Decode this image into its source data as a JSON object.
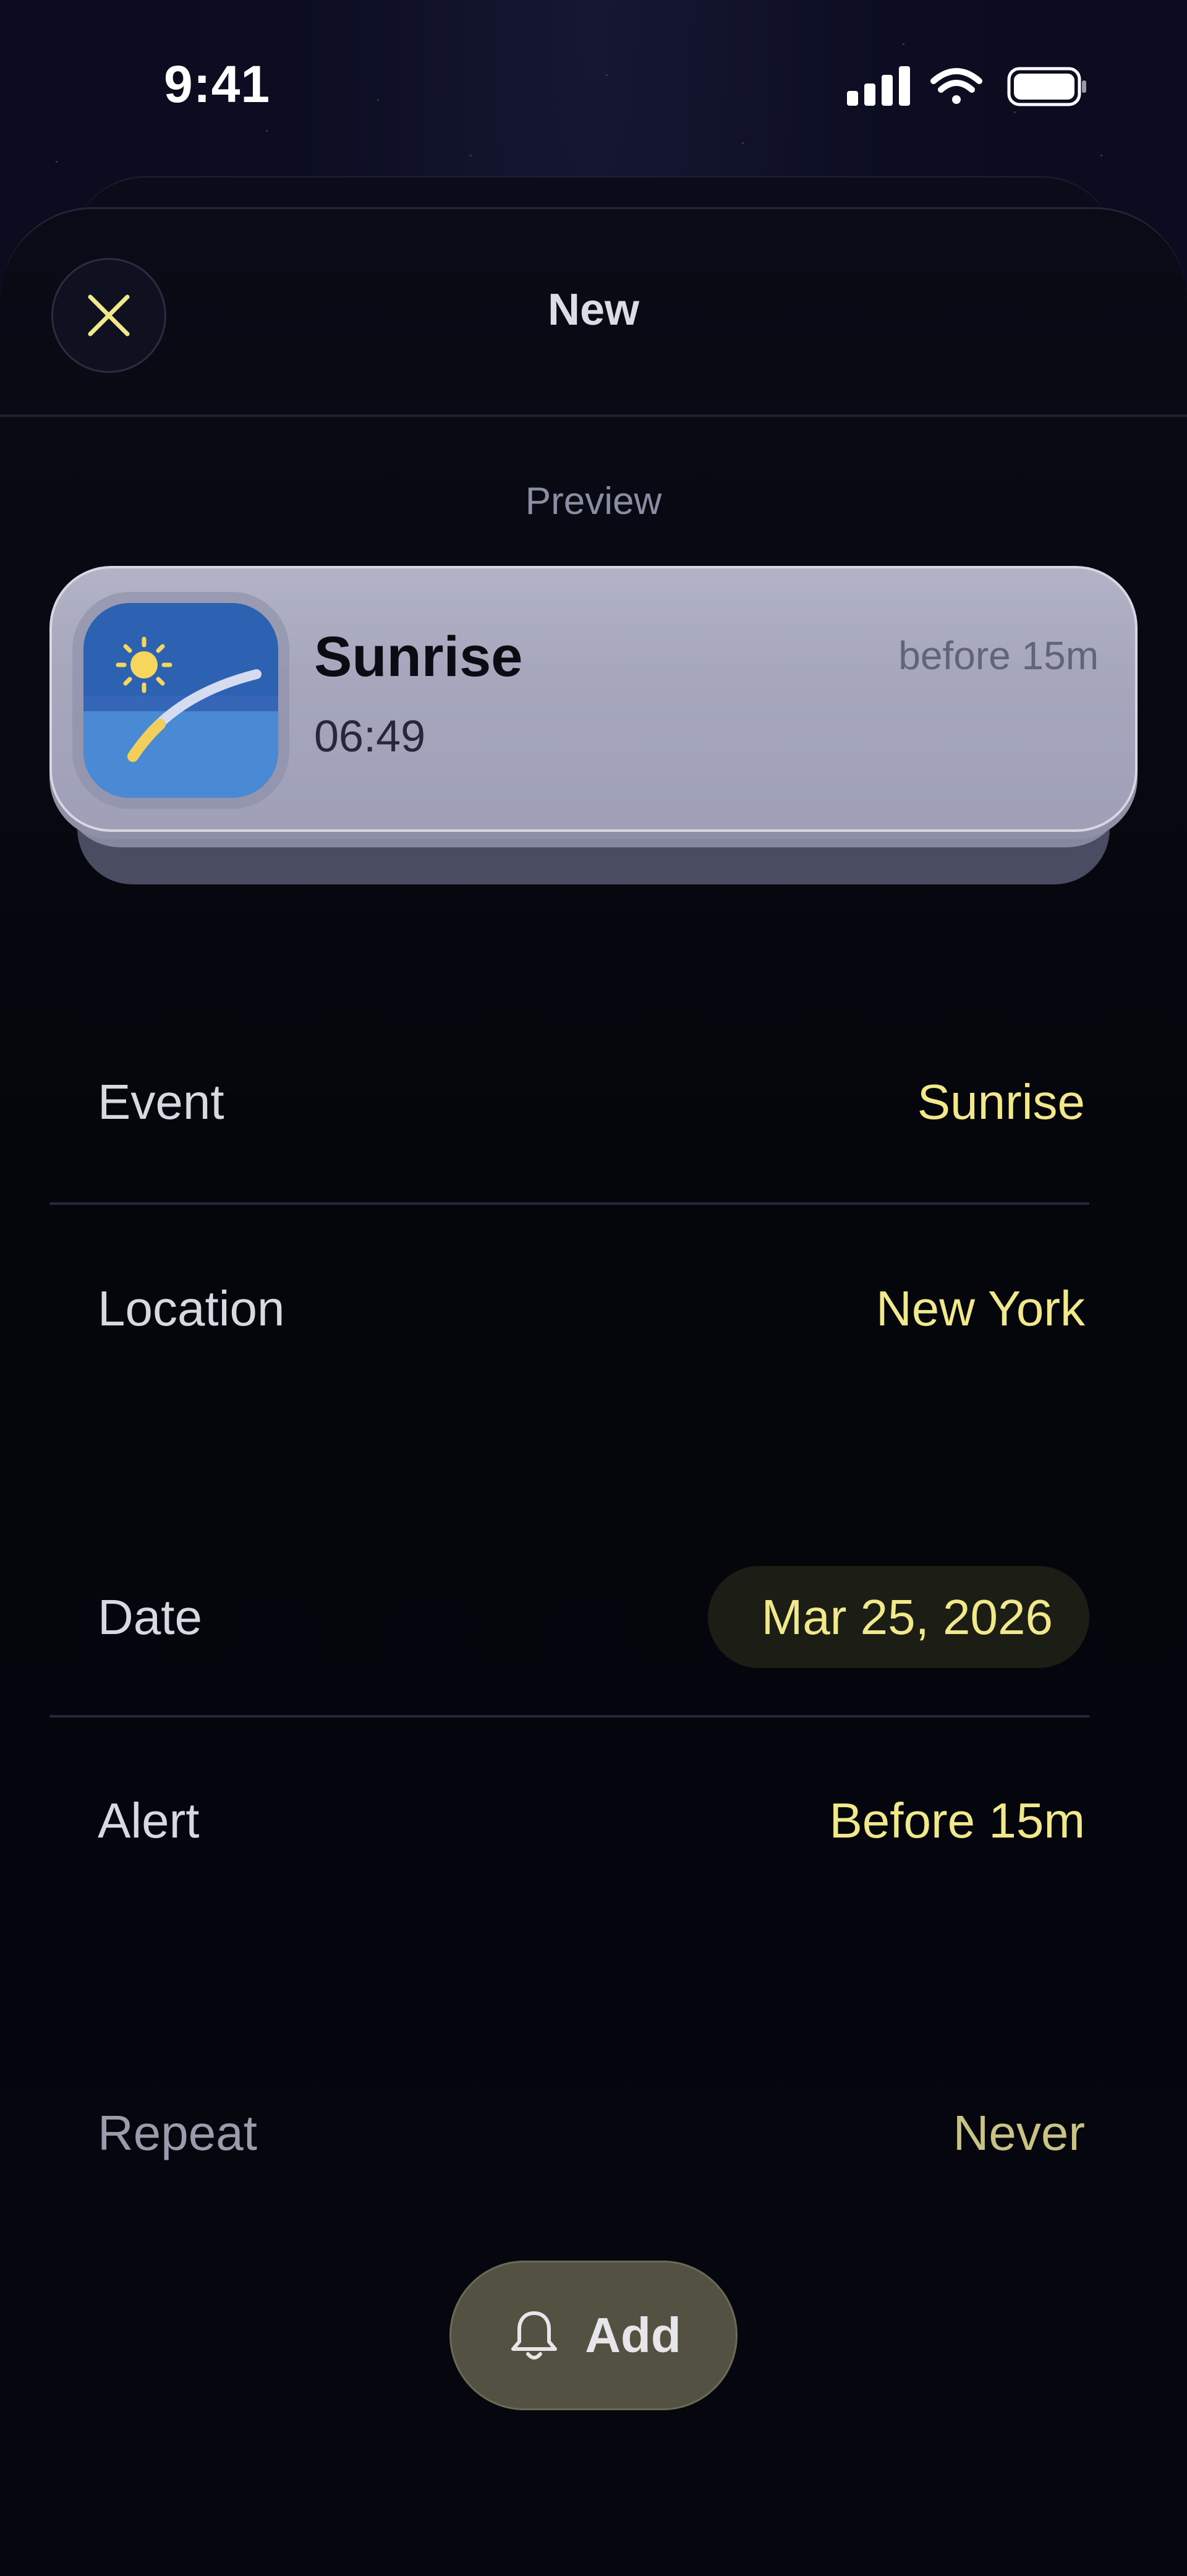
{
  "status_bar": {
    "time": "9:41",
    "icons": [
      "signal-icon",
      "wifi-icon",
      "battery-icon"
    ]
  },
  "header": {
    "title": "New",
    "close_icon": "close-icon"
  },
  "preview": {
    "label": "Preview",
    "notification": {
      "title": "Sunrise",
      "time": "06:49",
      "meta": "before 15m",
      "icon": "sunrise-app-icon"
    }
  },
  "rows": {
    "event": {
      "label": "Event",
      "value": "Sunrise"
    },
    "location": {
      "label": "Location",
      "value": "New York"
    },
    "date": {
      "label": "Date",
      "value": "Mar 25, 2026"
    },
    "alert": {
      "label": "Alert",
      "value": "Before 15m"
    },
    "repeat": {
      "label": "Repeat",
      "value": "Never"
    }
  },
  "add_button": {
    "label": "Add",
    "icon": "bell-icon"
  },
  "colors": {
    "accent": "#f0e88a",
    "background": "#05060e",
    "card": "#a6a7bd",
    "button": "#535242"
  }
}
